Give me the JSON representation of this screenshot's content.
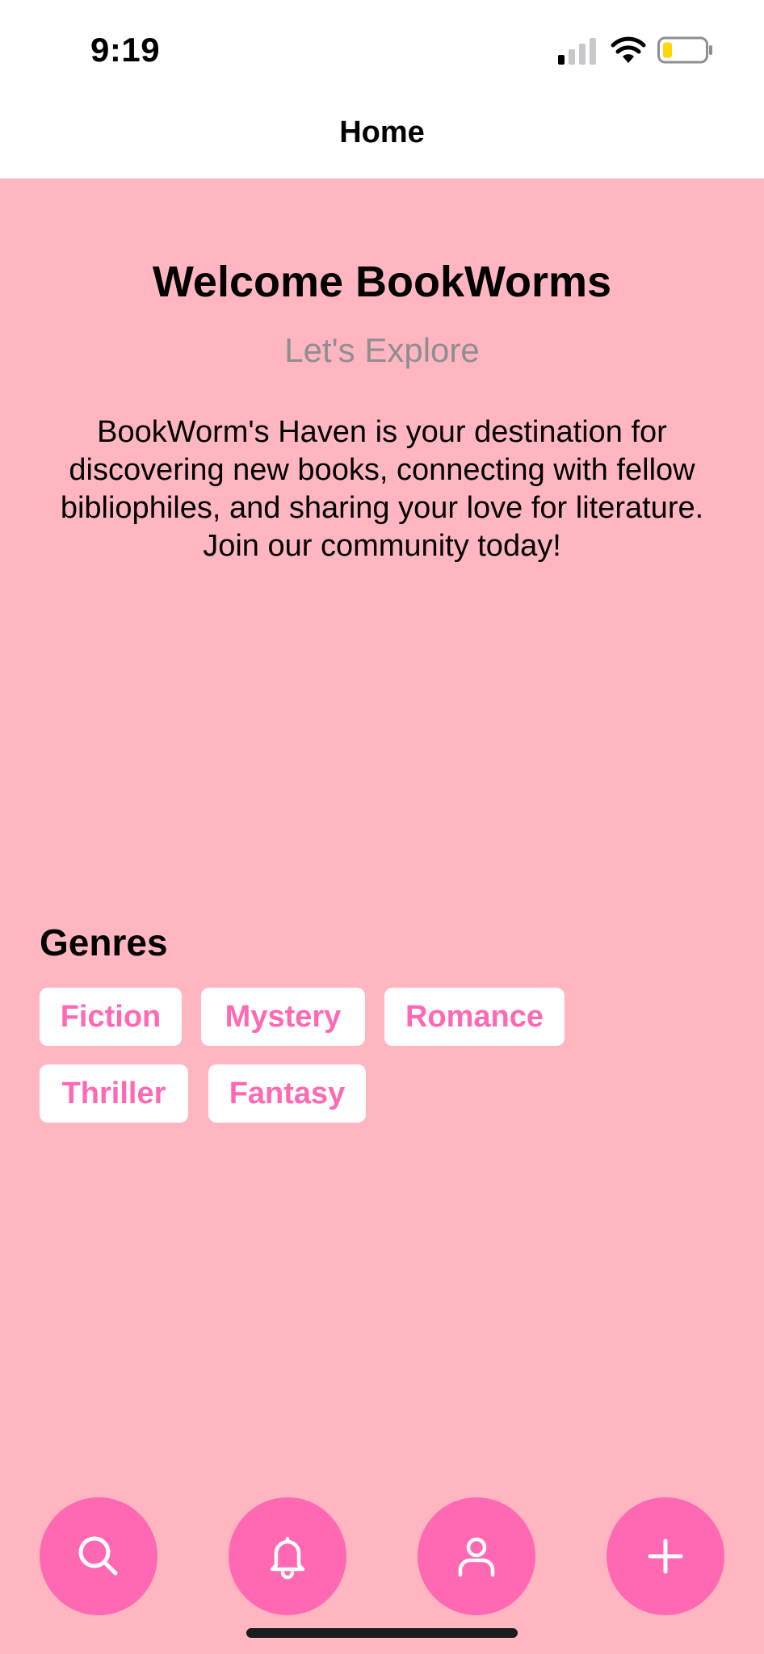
{
  "status_bar": {
    "time": "9:19"
  },
  "nav": {
    "title": "Home"
  },
  "hero": {
    "title": "Welcome BookWorms",
    "subtitle": "Let's Explore",
    "description": "BookWorm's Haven is your destination for discovering new books, connecting with fellow bibliophiles, and sharing your love for literature. Join our community today!"
  },
  "genres": {
    "heading": "Genres",
    "items": [
      "Fiction",
      "Mystery",
      "Romance",
      "Thriller",
      "Fantasy"
    ]
  },
  "fab_buttons": [
    {
      "icon": "search-icon"
    },
    {
      "icon": "bell-icon"
    },
    {
      "icon": "user-icon"
    },
    {
      "icon": "plus-icon"
    }
  ],
  "colors": {
    "background": "#ffb6c1",
    "accent": "#ff69b4",
    "bar_background": "#ffffff",
    "subtitle_gray": "#8e8e93",
    "battery_fill": "#ffd60a"
  }
}
